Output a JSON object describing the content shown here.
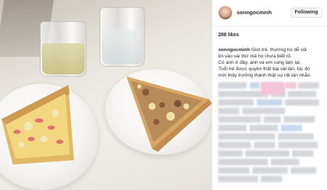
{
  "post": {
    "username": "sonngocminh",
    "follow_label": "Following",
    "likes": "288 likes",
    "time": "",
    "caption": {
      "user": "sonngocminh",
      "lines": [
        " Giới trẻ, thường họ dễ vội",
        "tin vào vài thứ mà họ chưa biết rõ.",
        "Có anh ở đây, anh và em cùng làm lại.",
        "Tuổi trẻ được quyền thất bại vài lần, lúc đó",
        "mới thấy trưởng thành thật sự rất tàn nhẫn."
      ]
    }
  },
  "colors": {
    "blur_gray": "#d5d6dc",
    "blur_pink": "#f2c6d6",
    "blur_blue": "#c9d6ea"
  }
}
